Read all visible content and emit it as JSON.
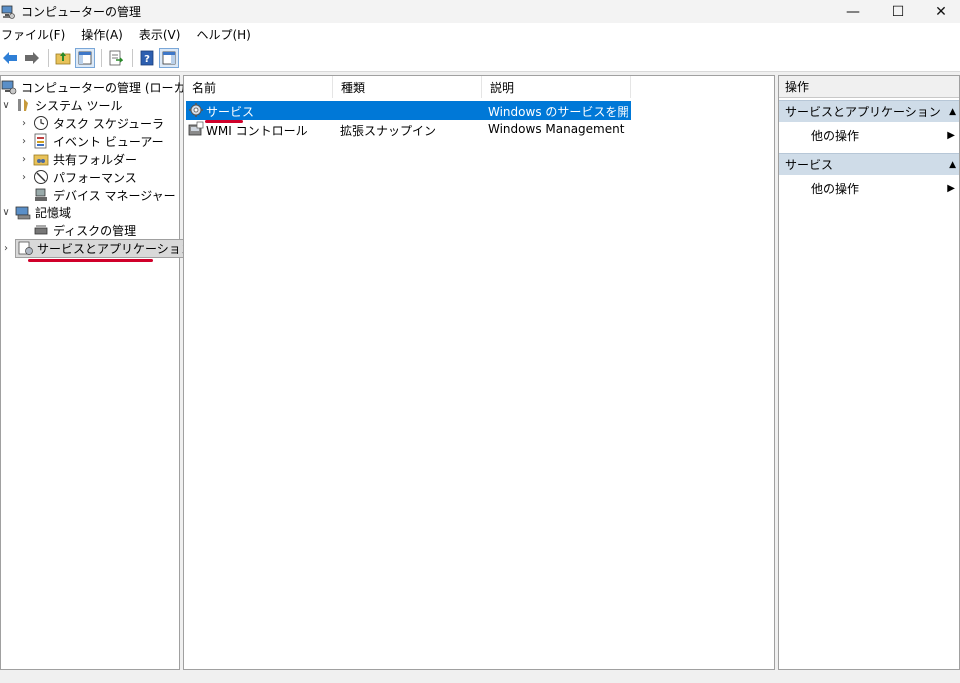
{
  "window": {
    "title": "コンピューターの管理",
    "minimize_glyph": "—",
    "maximize_glyph": "☐",
    "close_glyph": "✕"
  },
  "menu": [
    "ファイル(F)",
    "操作(A)",
    "表示(V)",
    "ヘルプ(H)"
  ],
  "tree": {
    "root": "コンピューターの管理 (ローカル)",
    "items": [
      {
        "label": "システム ツール",
        "icon": "tools-icon",
        "expander": "∨"
      },
      {
        "label": "タスク スケジューラ",
        "icon": "clock-icon",
        "expander": "›"
      },
      {
        "label": "イベント ビューアー",
        "icon": "event-viewer-icon",
        "expander": "›"
      },
      {
        "label": "共有フォルダー",
        "icon": "shared-folder-icon",
        "expander": "›"
      },
      {
        "label": "パフォーマンス",
        "icon": "performance-icon",
        "expander": "›"
      },
      {
        "label": "デバイス マネージャー",
        "icon": "device-manager-icon",
        "expander": ""
      },
      {
        "label": "記憶域",
        "icon": "storage-icon",
        "expander": "∨"
      },
      {
        "label": "ディスクの管理",
        "icon": "disk-icon",
        "expander": ""
      },
      {
        "label": "サービスとアプリケーション",
        "icon": "services-apps-icon",
        "expander": "›"
      }
    ]
  },
  "list": {
    "columns": [
      "名前",
      "種類",
      "説明"
    ],
    "rows": [
      {
        "name": "サービス",
        "type": "",
        "description": "Windows のサービスを開...",
        "icon": "gear-icon",
        "selected": true
      },
      {
        "name": "WMI コントロール",
        "type": "拡張スナップイン",
        "description": "Windows Management I...",
        "icon": "wmi-icon",
        "selected": false
      }
    ]
  },
  "actions": {
    "title": "操作",
    "sections": [
      {
        "header": "サービスとアプリケーション",
        "item": "他の操作"
      },
      {
        "header": "サービス",
        "item": "他の操作"
      }
    ]
  },
  "colors": {
    "selection": "#0078d7",
    "annotation": "#d0002a",
    "section_header": "#cfdce8"
  }
}
